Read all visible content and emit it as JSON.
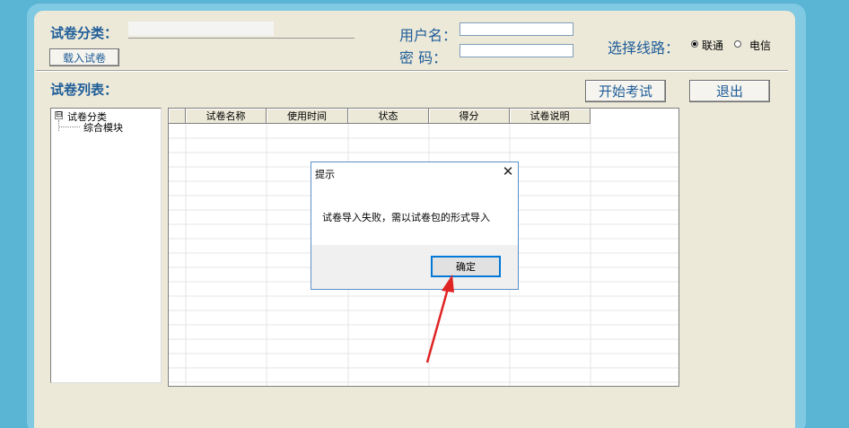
{
  "header": {
    "category_label": "试卷分类：",
    "load_button": "载入试卷",
    "username_label": "用户名：",
    "password_label": "密  码：",
    "username_value": "",
    "password_value": "",
    "line_label": "选择线路：",
    "line_options": [
      {
        "label": "联通",
        "selected": true
      },
      {
        "label": "电信",
        "selected": false
      }
    ]
  },
  "list_label": "试卷列表：",
  "buttons": {
    "start_exam": "开始考试",
    "exit": "退出"
  },
  "tree": {
    "expander": "⊟",
    "root": "试卷分类",
    "children": [
      "综合模块"
    ]
  },
  "grid": {
    "columns": [
      "试卷名称",
      "使用时间",
      "状态",
      "得分",
      "试卷说明"
    ]
  },
  "dialog": {
    "title": "提示",
    "close": "✕",
    "message": "试卷导入失败，需以试卷包的形式导入",
    "ok_button": "确定"
  },
  "colors": {
    "accent_blue": "#1f5d99",
    "background": "#5ab4d4",
    "panel": "#ece9d8",
    "arrow": "#e02424"
  }
}
